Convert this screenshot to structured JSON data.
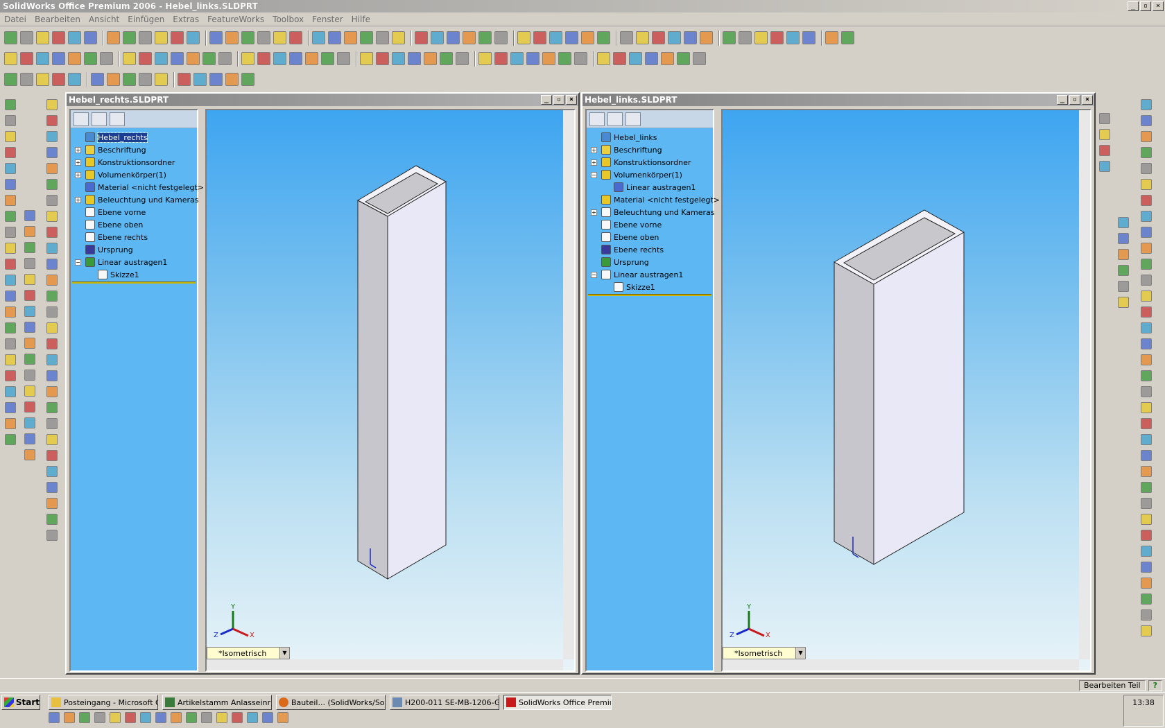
{
  "app": {
    "title": "SolidWorks Office Premium 2006 - Hebel_links.SLDPRT"
  },
  "window_controls": {
    "minimize": "_",
    "restore": "▫",
    "close": "×"
  },
  "menu": [
    "Datei",
    "Bearbeiten",
    "Ansicht",
    "Einfügen",
    "Extras",
    "FeatureWorks",
    "Toolbox",
    "Fenster",
    "Hilfe"
  ],
  "doc_left": {
    "title": "Hebel_rechts.SLDPRT",
    "tree": [
      {
        "label": "Hebel_rechts",
        "exp": "",
        "level": 0,
        "selected": true
      },
      {
        "label": "Beschriftung",
        "exp": "+",
        "level": 0
      },
      {
        "label": "Konstruktionsordner",
        "exp": "+",
        "level": 0
      },
      {
        "label": "Volumenkörper(1)",
        "exp": "+",
        "level": 0
      },
      {
        "label": "Material <nicht festgelegt>",
        "exp": "",
        "level": 0
      },
      {
        "label": "Beleuchtung und Kameras",
        "exp": "+",
        "level": 0
      },
      {
        "label": "Ebene vorne",
        "exp": "",
        "level": 0
      },
      {
        "label": "Ebene oben",
        "exp": "",
        "level": 0
      },
      {
        "label": "Ebene rechts",
        "exp": "",
        "level": 0
      },
      {
        "label": "Ursprung",
        "exp": "",
        "level": 0
      },
      {
        "label": "Linear austragen1",
        "exp": "−",
        "level": 0
      },
      {
        "label": "Skizze1",
        "exp": "",
        "level": 1
      }
    ],
    "view": "*Isometrisch"
  },
  "doc_right": {
    "title": "Hebel_links.SLDPRT",
    "tree": [
      {
        "label": "Hebel_links",
        "exp": "",
        "level": 0
      },
      {
        "label": "Beschriftung",
        "exp": "+",
        "level": 0
      },
      {
        "label": "Konstruktionsordner",
        "exp": "+",
        "level": 0
      },
      {
        "label": "Volumenkörper(1)",
        "exp": "−",
        "level": 0
      },
      {
        "label": "Linear austragen1",
        "exp": "",
        "level": 1
      },
      {
        "label": "Material <nicht festgelegt>",
        "exp": "",
        "level": 0
      },
      {
        "label": "Beleuchtung und Kameras",
        "exp": "+",
        "level": 0
      },
      {
        "label": "Ebene vorne",
        "exp": "",
        "level": 0
      },
      {
        "label": "Ebene oben",
        "exp": "",
        "level": 0
      },
      {
        "label": "Ebene rechts",
        "exp": "",
        "level": 0
      },
      {
        "label": "Ursprung",
        "exp": "",
        "level": 0
      },
      {
        "label": "Linear austragen1",
        "exp": "−",
        "level": 0
      },
      {
        "label": "Skizze1",
        "exp": "",
        "level": 1
      }
    ],
    "view": "*Isometrisch"
  },
  "axis_labels": {
    "x": "X",
    "y": "Y",
    "z": "Z"
  },
  "status": {
    "mode": "Bearbeiten Teil",
    "help": "?"
  },
  "taskbar": {
    "start": "Start",
    "buttons": [
      {
        "label": "Posteingang - Microsoft O...",
        "active": false
      },
      {
        "label": "Artikelstamm  Anlasseinric...",
        "active": false
      },
      {
        "label": "Bauteil... (SolidWorks/Soli...",
        "active": false
      },
      {
        "label": "H200-011 SE-MB-1206-G...",
        "active": false
      },
      {
        "label": "SolidWorks Office Premiu...",
        "active": true
      }
    ],
    "clock": "13:38"
  }
}
